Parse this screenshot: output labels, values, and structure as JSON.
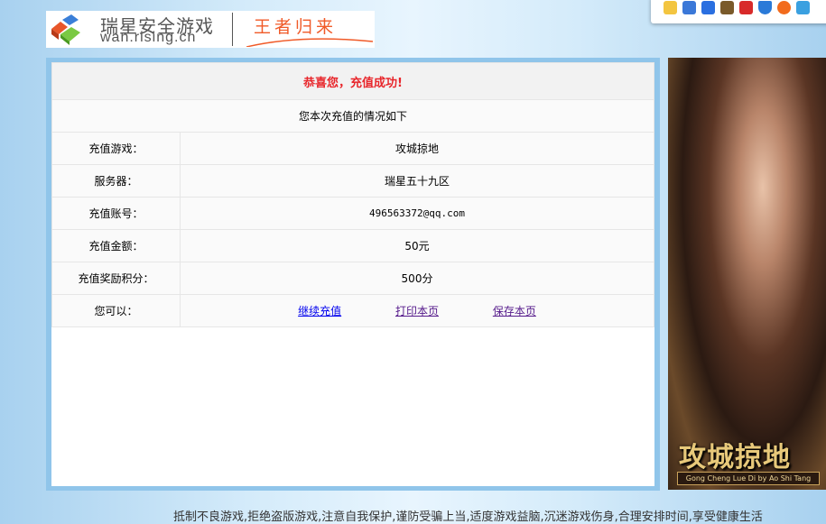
{
  "logo": {
    "name_cn": "瑞星安全游戏",
    "domain": "wan.rising.cn",
    "slogan": "王者归来"
  },
  "toolbar": {
    "icons": [
      "star-icon",
      "id-card-icon",
      "shield-check-icon",
      "treasure-chest-icon",
      "badge-icon",
      "shield-t-icon",
      "orange-swirl-icon",
      "game-character-icon"
    ]
  },
  "result": {
    "title": "恭喜您，充值成功!",
    "subtitle": "您本次充值的情况如下",
    "rows": [
      {
        "label": "充值游戏：",
        "value": "攻城掠地"
      },
      {
        "label": "服务器：",
        "value": "瑞星五十九区"
      },
      {
        "label": "充值账号：",
        "value": "496563372@qq.com"
      },
      {
        "label": "充值金额：",
        "value": "50元"
      },
      {
        "label": "充值奖励积分：",
        "value": "500分"
      }
    ],
    "actions_label": "您可以：",
    "actions": [
      "继续充值",
      "打印本页",
      "保存本页"
    ]
  },
  "promo": {
    "title": "攻城掠地",
    "subtitle": "Gong Cheng Lue Di by Ao Shi Tang"
  },
  "notice": "抵制不良游戏,拒绝盗版游戏,注意自我保护,谨防受骗上当,适度游戏益脑,沉迷游戏伤身,合理安排时间,享受健康生活"
}
